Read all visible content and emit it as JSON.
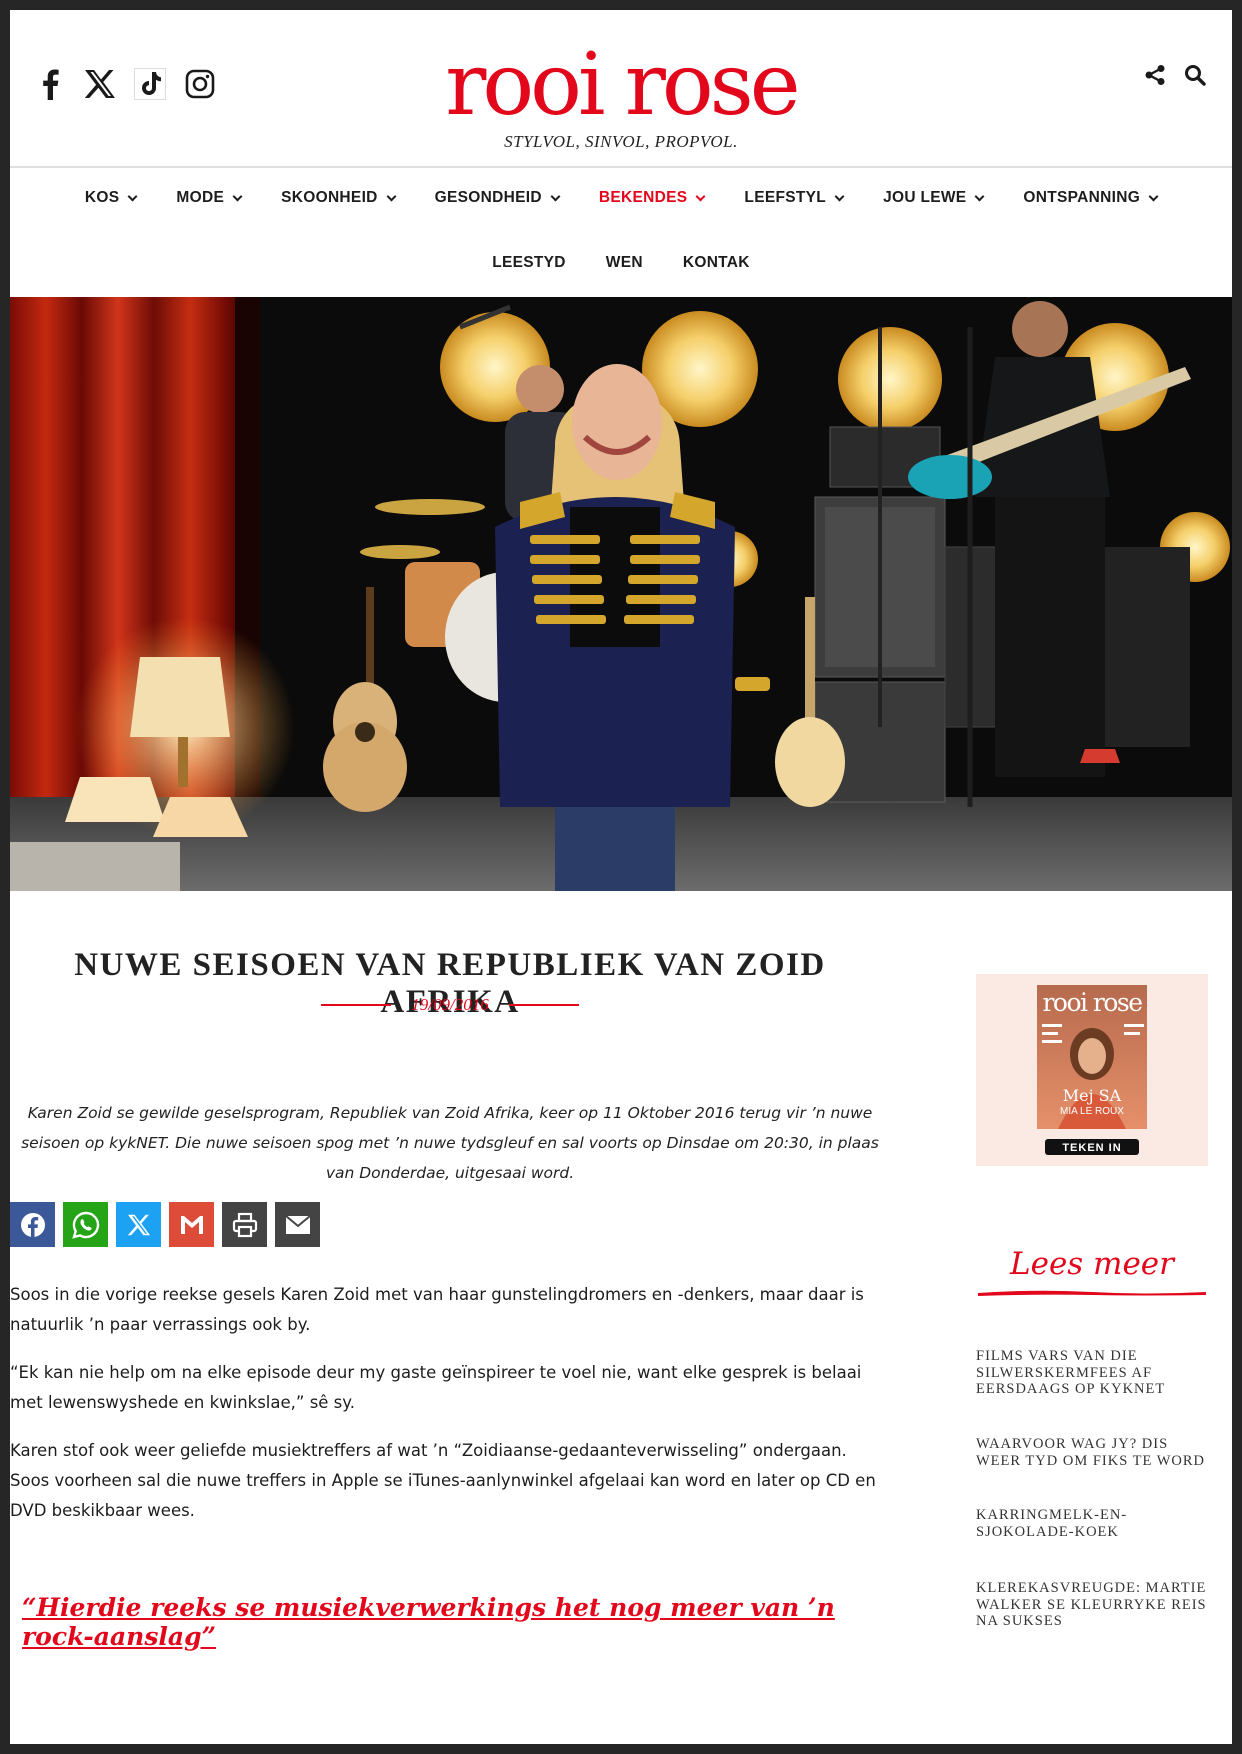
{
  "header": {
    "logo_text": "rooi rose",
    "tagline": "STYLVOL, SINVOL, PROPVOL.",
    "social_icons": [
      "facebook-icon",
      "x-icon",
      "tiktok-icon",
      "instagram-icon"
    ],
    "tool_icons": [
      "share-icon",
      "search-icon"
    ]
  },
  "nav": {
    "primary": [
      {
        "label": "KOS",
        "dropdown": true
      },
      {
        "label": "MODE",
        "dropdown": true
      },
      {
        "label": "SKOONHEID",
        "dropdown": true
      },
      {
        "label": "GESONDHEID",
        "dropdown": true
      },
      {
        "label": "BEKENDES",
        "dropdown": true,
        "active": true
      },
      {
        "label": "LEEFSTYL",
        "dropdown": true
      },
      {
        "label": "JOU LEWE",
        "dropdown": true
      },
      {
        "label": "ONTSPANNING",
        "dropdown": true
      }
    ],
    "secondary": [
      {
        "label": "LEESTYD"
      },
      {
        "label": "WEN"
      },
      {
        "label": "KONTAK"
      }
    ]
  },
  "article": {
    "title": "NUWE SEISOEN VAN REPUBLIEK VAN ZOID AFRIKA",
    "date": "19/09/2016",
    "lead": "Karen Zoid se gewilde geselsprogram, Republiek van Zoid Afrika, keer op 11 Oktober 2016 terug vir ’n nuwe seisoen op kykNET. Die nuwe seisoen spog met ’n nuwe tydsgleuf en sal voorts op Dinsdae om 20:30, in plaas van Donderdae, uitgesaai word.",
    "share_buttons": [
      {
        "name": "facebook",
        "color": "#3b5998"
      },
      {
        "name": "whatsapp",
        "color": "#25a418"
      },
      {
        "name": "x",
        "color": "#1da1f2"
      },
      {
        "name": "gmail",
        "color": "#dd4b39"
      },
      {
        "name": "print",
        "color": "#444444"
      },
      {
        "name": "email",
        "color": "#444444"
      }
    ],
    "paragraphs": [
      "Soos in die vorige reekse gesels Karen Zoid met van haar gunstelingdromers en -denkers, maar daar is natuurlik ’n paar verrassings ook by.",
      "“Ek kan nie help om na elke episode deur my gaste geïnspireer te voel nie, want elke gesprek is belaai met lewenswyshede en kwinkslae,” sê sy.",
      "Karen stof ook weer geliefde musiektreffers af wat ’n “Zoidiaanse-gedaanteverwisseling” ondergaan. Soos voorheen sal die nuwe treffers in Apple se iTunes-aanlynwinkel afgelaai kan word en later op CD en DVD beskikbaar wees."
    ],
    "pull_quote": "“Hierdie reeks se musiekverwerkings het nog meer van ’n rock-aanslag” "
  },
  "sidebar": {
    "magazine": {
      "masthead": "rooi rose",
      "cover_line": "Mej SA",
      "cover_name": "MIA LE ROUX",
      "cta": "TEKEN IN"
    },
    "lees_meer": "Lees meer",
    "related": [
      "FILMS VARS VAN DIE SILWERSKERMFEES AF EERSDAAGS OP KYKNET",
      "WAARVOOR WAG JY? DIS WEER TYD OM FIKS TE WORD",
      "KARRINGMELK-EN-SJOKOLADE-KOEK",
      "KLEREKASVREUGDE: MARTIE WALKER SE KLEURRYKE REIS NA SUKSES"
    ]
  },
  "colors": {
    "brand_red": "#e2071b",
    "frame": "#262626"
  }
}
